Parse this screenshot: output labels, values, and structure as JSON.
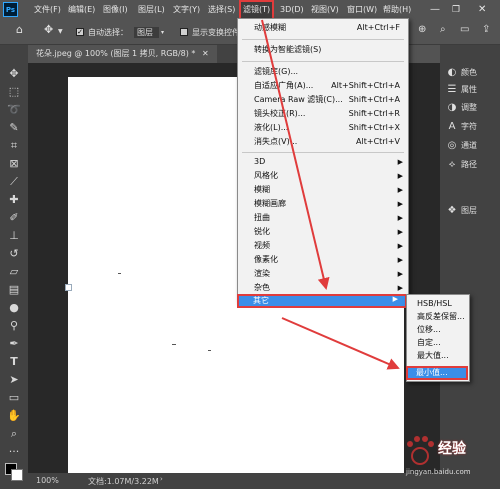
{
  "menubar": {
    "logo": "Ps",
    "items": [
      "文件(F)",
      "编辑(E)",
      "图像(I)",
      "图层(L)",
      "文字(Y)",
      "选择(S)",
      "滤镜(T)",
      "3D(D)",
      "视图(V)",
      "窗口(W)",
      "帮助(H)"
    ]
  },
  "options": {
    "auto_select_label": "自动选择：",
    "auto_select_value": "图层",
    "show_transform_label": "显示变换控件"
  },
  "document": {
    "tab_title": "花朵.jpeg @ 100% (图层 1 拷贝, RGB/8) *",
    "zoom": "100%",
    "doc_info": "文档:1.07M/3.22M"
  },
  "filter_menu": {
    "top_items": [
      {
        "label": "动感模糊",
        "shortcut": "Alt+Ctrl+F"
      },
      {
        "label": "转换为智能滤镜(S)",
        "shortcut": ""
      }
    ],
    "mid_items": [
      {
        "label": "滤镜库(G)...",
        "shortcut": ""
      },
      {
        "label": "自适应广角(A)...",
        "shortcut": "Alt+Shift+Ctrl+A"
      },
      {
        "label": "Camera Raw 滤镜(C)...",
        "shortcut": "Shift+Ctrl+A"
      },
      {
        "label": "镜头校正(R)...",
        "shortcut": "Shift+Ctrl+R"
      },
      {
        "label": "液化(L)...",
        "shortcut": "Shift+Ctrl+X"
      },
      {
        "label": "消失点(V)...",
        "shortcut": "Alt+Ctrl+V"
      }
    ],
    "submenus": [
      "3D",
      "风格化",
      "模糊",
      "模糊画廊",
      "扭曲",
      "锐化",
      "视频",
      "像素化",
      "渲染",
      "杂色"
    ],
    "other": "其它"
  },
  "other_menu": {
    "items": [
      "HSB/HSL",
      "高反差保留...",
      "位移...",
      "自定...",
      "最大值..."
    ],
    "minimum": "最小值..."
  },
  "right_panel": {
    "items": [
      "颜色",
      "属性",
      "调整",
      "字符",
      "通道",
      "路径",
      "图层"
    ]
  },
  "watermark": {
    "text": "经验",
    "sub": "jingyan.baidu.com"
  },
  "colors": {
    "accent_highlight": "#3b8ee8",
    "annotation_red": "#e03c3c"
  }
}
